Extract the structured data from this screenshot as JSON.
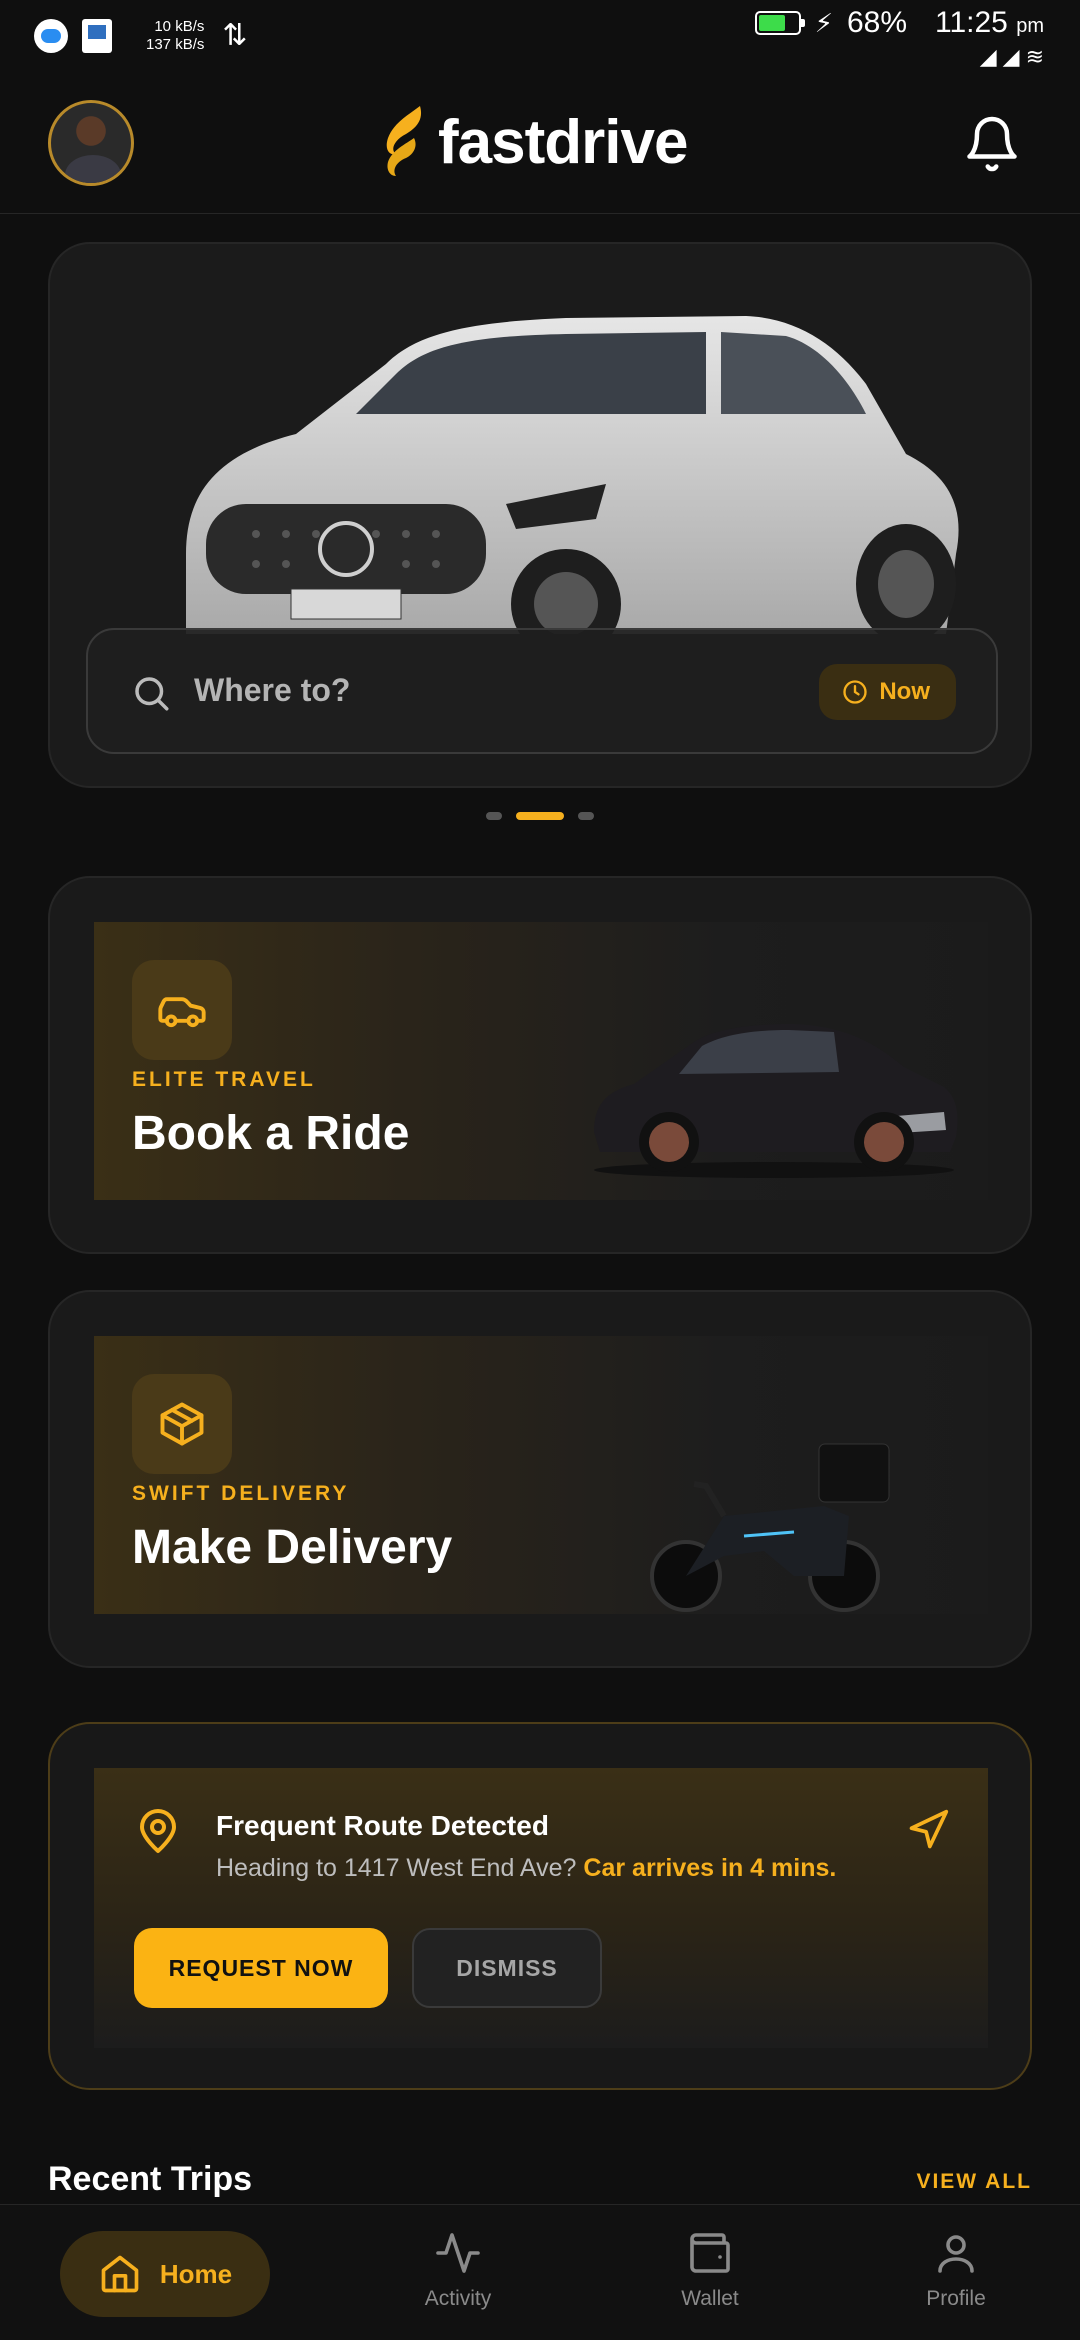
{
  "status_bar": {
    "speed_up": "10 kB/s",
    "speed_down": "137 kB/s",
    "battery_percent": "68%",
    "battery_level": 0.68,
    "time": "11:25",
    "time_suffix": "pm"
  },
  "header": {
    "brand": "fastdrive",
    "avatar": "profile-avatar",
    "notification_icon": "bell-icon"
  },
  "hero": {
    "search_placeholder": "Where to?",
    "schedule_label": "Now",
    "carousel_pages": 3,
    "carousel_active": 1
  },
  "services": [
    {
      "eyebrow": "ELITE TRAVEL",
      "title": "Book a Ride",
      "icon": "car-icon"
    },
    {
      "eyebrow": "SWIFT DELIVERY",
      "title": "Make Delivery",
      "icon": "package-icon"
    }
  ],
  "route_suggestion": {
    "title": "Frequent Route Detected",
    "description": "Heading to 1417 West End Ave?",
    "highlight": "Car arrives in 4 mins.",
    "primary_button": "REQUEST NOW",
    "secondary_button": "DISMISS"
  },
  "recent_trips": {
    "title": "Recent Trips",
    "view_all": "VIEW ALL"
  },
  "bottom_nav": {
    "home": "Home",
    "activity": "Activity",
    "wallet": "Wallet",
    "profile": "Profile"
  },
  "colors": {
    "accent": "#f6b01e",
    "background": "#0f0f0f",
    "card": "#1b1b1b"
  }
}
